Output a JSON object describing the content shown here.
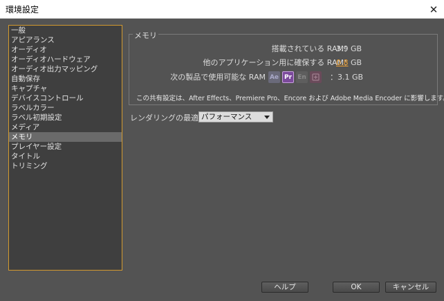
{
  "window": {
    "title": "環境設定",
    "close_symbol": "✕"
  },
  "sidebar": {
    "items": [
      {
        "label": "一般"
      },
      {
        "label": "アピアランス"
      },
      {
        "label": "オーディオ"
      },
      {
        "label": "オーディオハードウェア"
      },
      {
        "label": "オーディオ出力マッピング"
      },
      {
        "label": "自動保存"
      },
      {
        "label": "キャプチャ"
      },
      {
        "label": "デバイスコントロール"
      },
      {
        "label": "ラベルカラー"
      },
      {
        "label": "ラベル初期設定"
      },
      {
        "label": "メディア"
      },
      {
        "label": "メモリ",
        "selected": true
      },
      {
        "label": "プレイヤー設定"
      },
      {
        "label": "タイトル"
      },
      {
        "label": "トリミング"
      }
    ]
  },
  "memory": {
    "group_title": "メモリ",
    "installed_label": "搭載されている RAM：",
    "installed_value": "3.9 GB",
    "reserved_label": "他のアプリケーション用に確保する RAM：",
    "reserved_value": "0.8",
    "reserved_unit": "GB",
    "available_label": "次の製品で使用可能な RAM",
    "available_value": "：3.1 GB",
    "apps": [
      {
        "label": "Ae",
        "icon": "after-effects-icon"
      },
      {
        "label": "Pr",
        "icon": "premiere-pro-icon"
      },
      {
        "label": "En",
        "icon": "encore-icon"
      },
      {
        "label": "",
        "icon": "media-encoder-icon"
      }
    ],
    "note": "この共有設定は、After Effects、Premiere Pro、Encore および Adobe Media Encoder に影響します。"
  },
  "render_opt": {
    "label": "レンダリングの最適化：",
    "value": "パフォーマンス"
  },
  "buttons": {
    "help": "ヘルプ",
    "ok": "OK",
    "cancel": "キャンセル"
  },
  "colors": {
    "accent": "#d39a2f",
    "background": "#535353",
    "reserved_value": "#f0a030"
  }
}
